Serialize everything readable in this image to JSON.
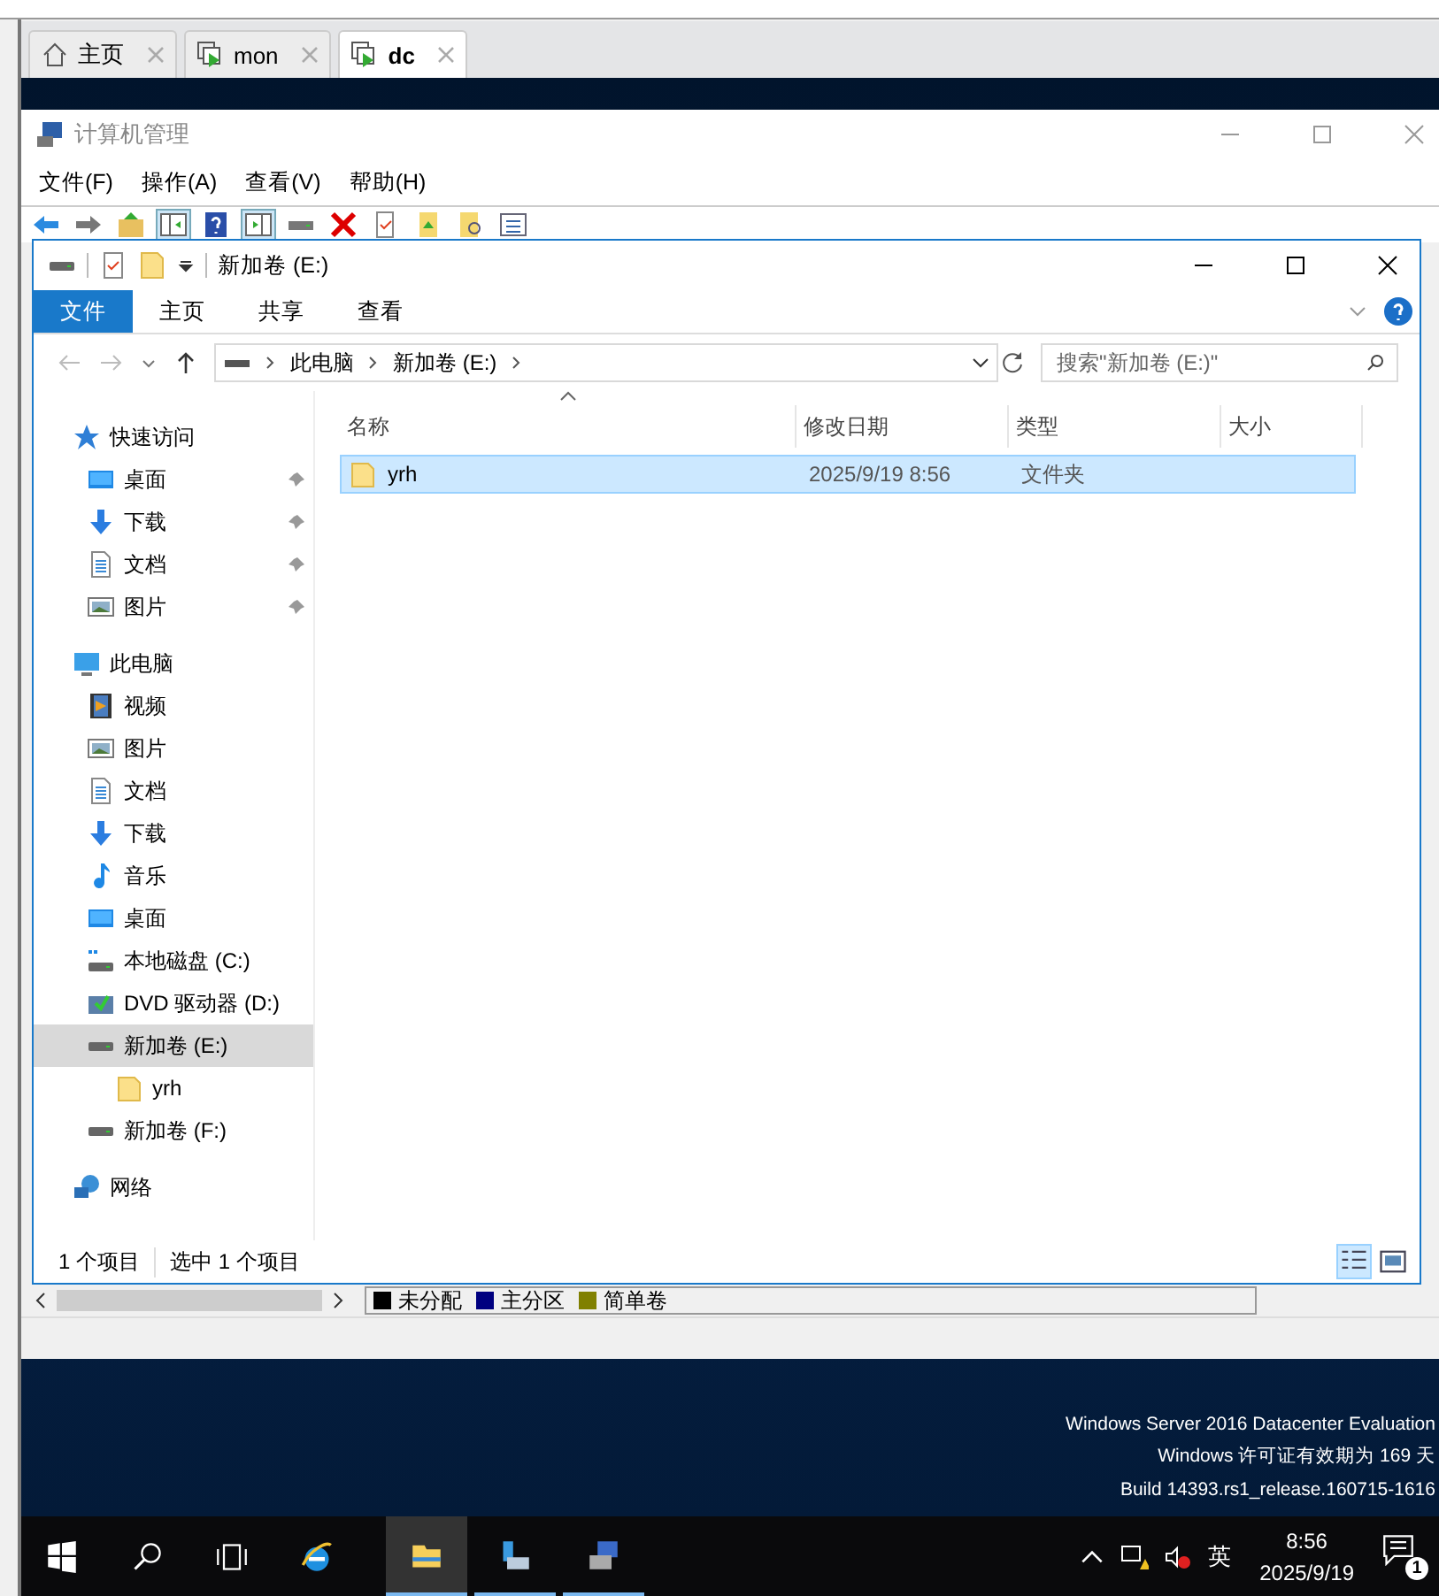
{
  "vm_tabs": [
    {
      "label": "主页",
      "kind": "home",
      "selected": false
    },
    {
      "label": "mon",
      "kind": "vm",
      "selected": false
    },
    {
      "label": "dc",
      "kind": "vm",
      "selected": true
    }
  ],
  "mmc": {
    "title": "计算机管理",
    "menu": [
      "文件(F)",
      "操作(A)",
      "查看(V)",
      "帮助(H)"
    ],
    "legend": [
      {
        "label": "未分配",
        "color": "#000000"
      },
      {
        "label": "主分区",
        "color": "#000080"
      },
      {
        "label": "简单卷",
        "color": "#808000"
      }
    ]
  },
  "explorer": {
    "title": "新加卷 (E:)",
    "ribbon_tabs": [
      {
        "label": "文件",
        "selected": true
      },
      {
        "label": "主页",
        "selected": false
      },
      {
        "label": "共享",
        "selected": false
      },
      {
        "label": "查看",
        "selected": false
      }
    ],
    "breadcrumb": [
      "此电脑",
      "新加卷 (E:)"
    ],
    "search": {
      "placeholder": "搜索\"新加卷 (E:)\""
    },
    "nav": [
      {
        "label": "快速访问",
        "kind": "star",
        "selected": false,
        "children": [
          {
            "label": "桌面",
            "kind": "desktop",
            "pinned": true,
            "selected": false
          },
          {
            "label": "下载",
            "kind": "download",
            "pinned": true,
            "selected": false
          },
          {
            "label": "文档",
            "kind": "document",
            "pinned": true,
            "selected": false
          },
          {
            "label": "图片",
            "kind": "picture",
            "pinned": true,
            "selected": false
          }
        ]
      },
      {
        "label": "此电脑",
        "kind": "pc",
        "selected": false,
        "children": [
          {
            "label": "视频",
            "kind": "video",
            "selected": false
          },
          {
            "label": "图片",
            "kind": "picture",
            "selected": false
          },
          {
            "label": "文档",
            "kind": "document",
            "selected": false
          },
          {
            "label": "下载",
            "kind": "download",
            "selected": false
          },
          {
            "label": "音乐",
            "kind": "music",
            "selected": false
          },
          {
            "label": "桌面",
            "kind": "desktop",
            "selected": false
          },
          {
            "label": "本地磁盘 (C:)",
            "kind": "system-drive",
            "selected": false
          },
          {
            "label": "DVD 驱动器 (D:)",
            "kind": "dvd",
            "selected": false
          },
          {
            "label": "新加卷 (E:)",
            "kind": "drive",
            "selected": true,
            "children": [
              {
                "label": "yrh",
                "kind": "folder",
                "selected": false
              }
            ]
          },
          {
            "label": "新加卷 (F:)",
            "kind": "drive",
            "selected": false
          }
        ]
      },
      {
        "label": "网络",
        "kind": "network",
        "selected": false
      }
    ],
    "columns": [
      "名称",
      "修改日期",
      "类型",
      "大小"
    ],
    "rows": [
      {
        "name": "yrh",
        "date": "2025/9/19 8:56",
        "type": "文件夹",
        "selected": true
      }
    ],
    "status": [
      "1 个项目",
      "选中 1 个项目"
    ]
  },
  "desktop_text": [
    "Windows Server 2016 Datacenter Evaluation",
    "Windows 许可证有效期为 169 天",
    "Build 14393.rs1_release.160715-1616"
  ],
  "taskbar": {
    "input_method": "英",
    "time": "8:56",
    "date": "2025/9/19",
    "notification_count": "1"
  }
}
